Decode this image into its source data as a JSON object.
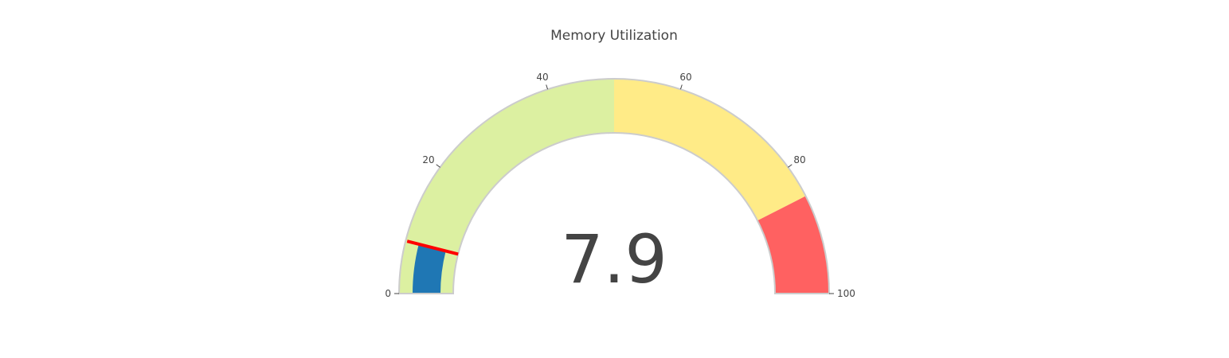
{
  "chart_data": {
    "type": "gauge",
    "title": "Memory Utilization",
    "value": 7.9,
    "value_label": "7.9",
    "range": [
      0,
      100
    ],
    "threshold": 7.9,
    "ticks": [
      {
        "value": 0,
        "label": "0"
      },
      {
        "value": 20,
        "label": "20"
      },
      {
        "value": 40,
        "label": "40"
      },
      {
        "value": 60,
        "label": "60"
      },
      {
        "value": 80,
        "label": "80"
      },
      {
        "value": 100,
        "label": "100"
      }
    ],
    "steps": [
      {
        "from": 0,
        "to": 50,
        "color": "#dcf0a1"
      },
      {
        "from": 50,
        "to": 85,
        "color": "#ffeb87"
      },
      {
        "from": 85,
        "to": 100,
        "color": "#ff6161"
      }
    ],
    "bar_color": "#1f77b4",
    "threshold_color": "#ff0000",
    "border_color": "#cccccc"
  }
}
